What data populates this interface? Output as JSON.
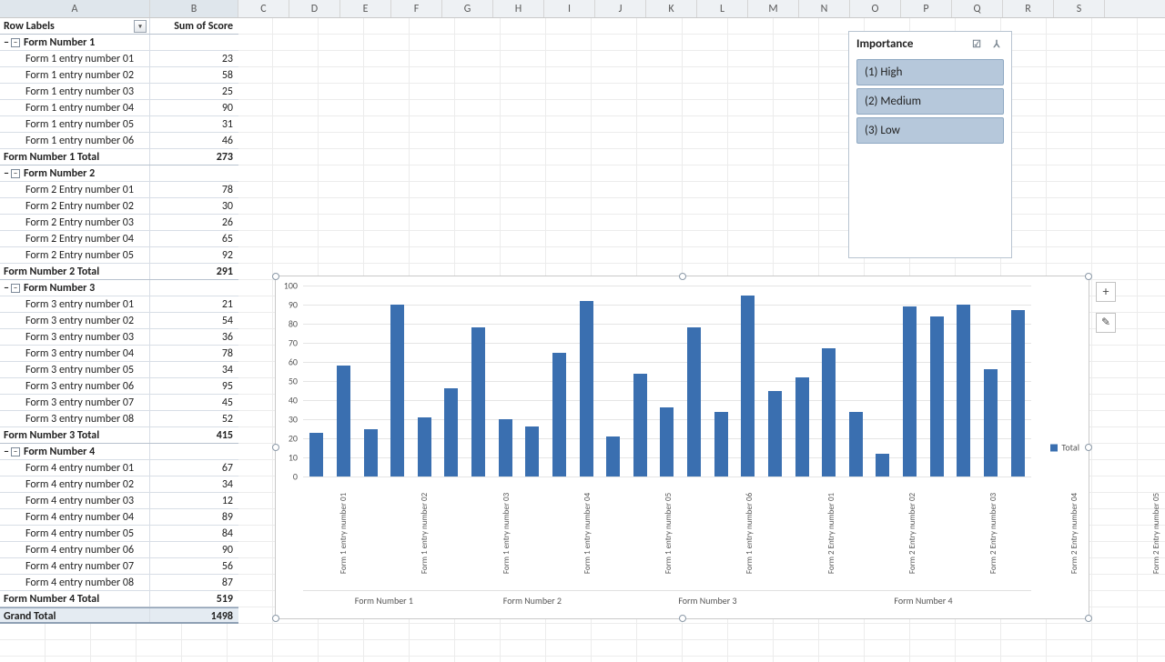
{
  "columns": [
    "A",
    "B",
    "C",
    "D",
    "E",
    "F",
    "G",
    "H",
    "I",
    "J",
    "K",
    "L",
    "M",
    "N",
    "O",
    "P",
    "Q",
    "R",
    "S"
  ],
  "pivot": {
    "header_label": "Row Labels",
    "header_value": "Sum of Score",
    "groups": [
      {
        "name": "Form Number 1",
        "total": 273,
        "entries": [
          {
            "label": "Form 1 entry number 01",
            "value": 23
          },
          {
            "label": "Form 1 entry number 02",
            "value": 58
          },
          {
            "label": "Form 1 entry number 03",
            "value": 25
          },
          {
            "label": "Form 1 entry number 04",
            "value": 90
          },
          {
            "label": "Form 1 entry number 05",
            "value": 31
          },
          {
            "label": "Form 1 entry number 06",
            "value": 46
          }
        ]
      },
      {
        "name": "Form Number 2",
        "total": 291,
        "entries": [
          {
            "label": "Form 2 Entry number 01",
            "value": 78
          },
          {
            "label": "Form 2 Entry number 02",
            "value": 30
          },
          {
            "label": "Form 2 Entry number 03",
            "value": 26
          },
          {
            "label": "Form 2 Entry number 04",
            "value": 65
          },
          {
            "label": "Form 2 Entry number 05",
            "value": 92
          }
        ]
      },
      {
        "name": "Form Number 3",
        "total": 415,
        "entries": [
          {
            "label": "Form 3 entry number 01",
            "value": 21
          },
          {
            "label": "Form 3 entry number 02",
            "value": 54
          },
          {
            "label": "Form 3 entry number 03",
            "value": 36
          },
          {
            "label": "Form 3 entry number 04",
            "value": 78
          },
          {
            "label": "Form 3 entry number 05",
            "value": 34
          },
          {
            "label": "Form 3 entry number 06",
            "value": 95
          },
          {
            "label": "Form 3 entry number 07",
            "value": 45
          },
          {
            "label": "Form 3 entry number 08",
            "value": 52
          }
        ]
      },
      {
        "name": "Form Number 4",
        "total": 519,
        "entries": [
          {
            "label": "Form 4 entry number 01",
            "value": 67
          },
          {
            "label": "Form 4 entry number 02",
            "value": 34
          },
          {
            "label": "Form 4 entry number 03",
            "value": 12
          },
          {
            "label": "Form 4 entry number 04",
            "value": 89
          },
          {
            "label": "Form 4 entry number 05",
            "value": 84
          },
          {
            "label": "Form 4 entry number 06",
            "value": 90
          },
          {
            "label": "Form 4 entry number 07",
            "value": 56
          },
          {
            "label": "Form 4 entry number 08",
            "value": 87
          }
        ]
      }
    ],
    "totals_suffix": " Total",
    "grand_label": "Grand Total",
    "grand_value": 1498
  },
  "slicer": {
    "title": "Importance",
    "items": [
      "(1) High",
      "(2) Medium",
      "(3) Low"
    ]
  },
  "chart_buttons": {
    "plus": "+",
    "brush": "✎"
  },
  "chart_data": {
    "type": "bar",
    "ylim": [
      0,
      100
    ],
    "yticks": [
      0,
      10,
      20,
      30,
      40,
      50,
      60,
      70,
      80,
      90,
      100
    ],
    "legend": "Total",
    "groups": [
      {
        "name": "Form Number 1",
        "entries": [
          {
            "label": "Form 1 entry number 01",
            "value": 23
          },
          {
            "label": "Form 1 entry number 02",
            "value": 58
          },
          {
            "label": "Form 1 entry number 03",
            "value": 25
          },
          {
            "label": "Form 1 entry number 04",
            "value": 90
          },
          {
            "label": "Form 1 entry number 05",
            "value": 31
          },
          {
            "label": "Form 1 entry number 06",
            "value": 46
          }
        ]
      },
      {
        "name": "Form Number 2",
        "entries": [
          {
            "label": "Form 2 Entry number 01",
            "value": 78
          },
          {
            "label": "Form 2 Entry number 02",
            "value": 30
          },
          {
            "label": "Form 2 Entry number 03",
            "value": 26
          },
          {
            "label": "Form 2 Entry number 04",
            "value": 65
          },
          {
            "label": "Form 2 Entry number 05",
            "value": 92
          }
        ]
      },
      {
        "name": "Form Number 3",
        "entries": [
          {
            "label": "Form 3 entry number 01",
            "value": 21
          },
          {
            "label": "Form 3 entry number 02",
            "value": 54
          },
          {
            "label": "Form 3 entry number 03",
            "value": 36
          },
          {
            "label": "Form 3 entry number 04",
            "value": 78
          },
          {
            "label": "Form 3 entry number 05",
            "value": 34
          },
          {
            "label": "Form 3 entry number 06",
            "value": 95
          },
          {
            "label": "Form 3 entry number 07",
            "value": 45
          },
          {
            "label": "Form 3 entry number 08",
            "value": 52
          }
        ]
      },
      {
        "name": "Form Number 4",
        "entries": [
          {
            "label": "Form 4 entry number 01",
            "value": 67
          },
          {
            "label": "Form 4 entry number 02",
            "value": 34
          },
          {
            "label": "Form 4 entry number 03",
            "value": 12
          },
          {
            "label": "Form 4 entry number 04",
            "value": 89
          },
          {
            "label": "Form 4 entry number 05",
            "value": 84
          },
          {
            "label": "Form 4 entry number 06",
            "value": 90
          },
          {
            "label": "Form 4 entry number 07",
            "value": 56
          },
          {
            "label": "Form 4 entry number 08",
            "value": 87
          }
        ]
      }
    ]
  },
  "colors": {
    "bar": "#3a6fb0",
    "slicer_item": "#b6c8db"
  }
}
